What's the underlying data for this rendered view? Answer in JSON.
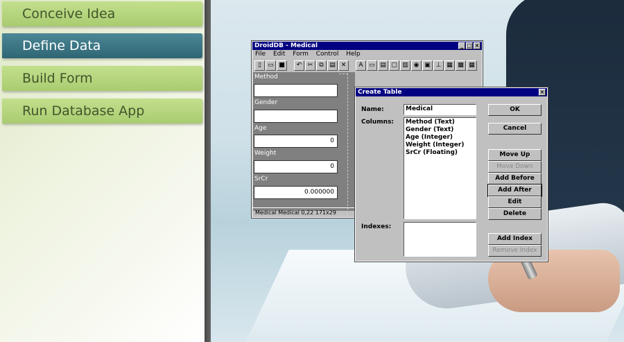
{
  "steps": [
    {
      "label": "Conceive Idea"
    },
    {
      "label": "Define Data"
    },
    {
      "label": "Build Form"
    },
    {
      "label": "Run Database App"
    }
  ],
  "droid_window": {
    "title": "DroidDB - Medical",
    "menu": [
      "File",
      "Edit",
      "Form",
      "Control",
      "Help"
    ],
    "fields": [
      {
        "label": "Method",
        "value": ""
      },
      {
        "label": "Gender",
        "value": ""
      },
      {
        "label": "Age",
        "value": "0"
      },
      {
        "label": "Weight",
        "value": "0"
      },
      {
        "label": "SrCr",
        "value": "0.000000"
      }
    ],
    "status": "Medical   Medical   0,22   171x29"
  },
  "create_table": {
    "title": "Create Table",
    "name_label": "Name:",
    "name_value": "Medical",
    "columns_label": "Columns:",
    "columns": [
      "Method (Text)",
      "Gender (Text)",
      "Age (Integer)",
      "Weight (Integer)",
      "SrCr (Floating)"
    ],
    "indexes_label": "Indexes:",
    "buttons": {
      "ok": "OK",
      "cancel": "Cancel",
      "move_up": "Move Up",
      "move_down": "Move Down",
      "add_before": "Add Before",
      "add_after": "Add After",
      "edit": "Edit",
      "delete": "Delete",
      "add_index": "Add Index",
      "remove_index": "Remove Index"
    }
  }
}
